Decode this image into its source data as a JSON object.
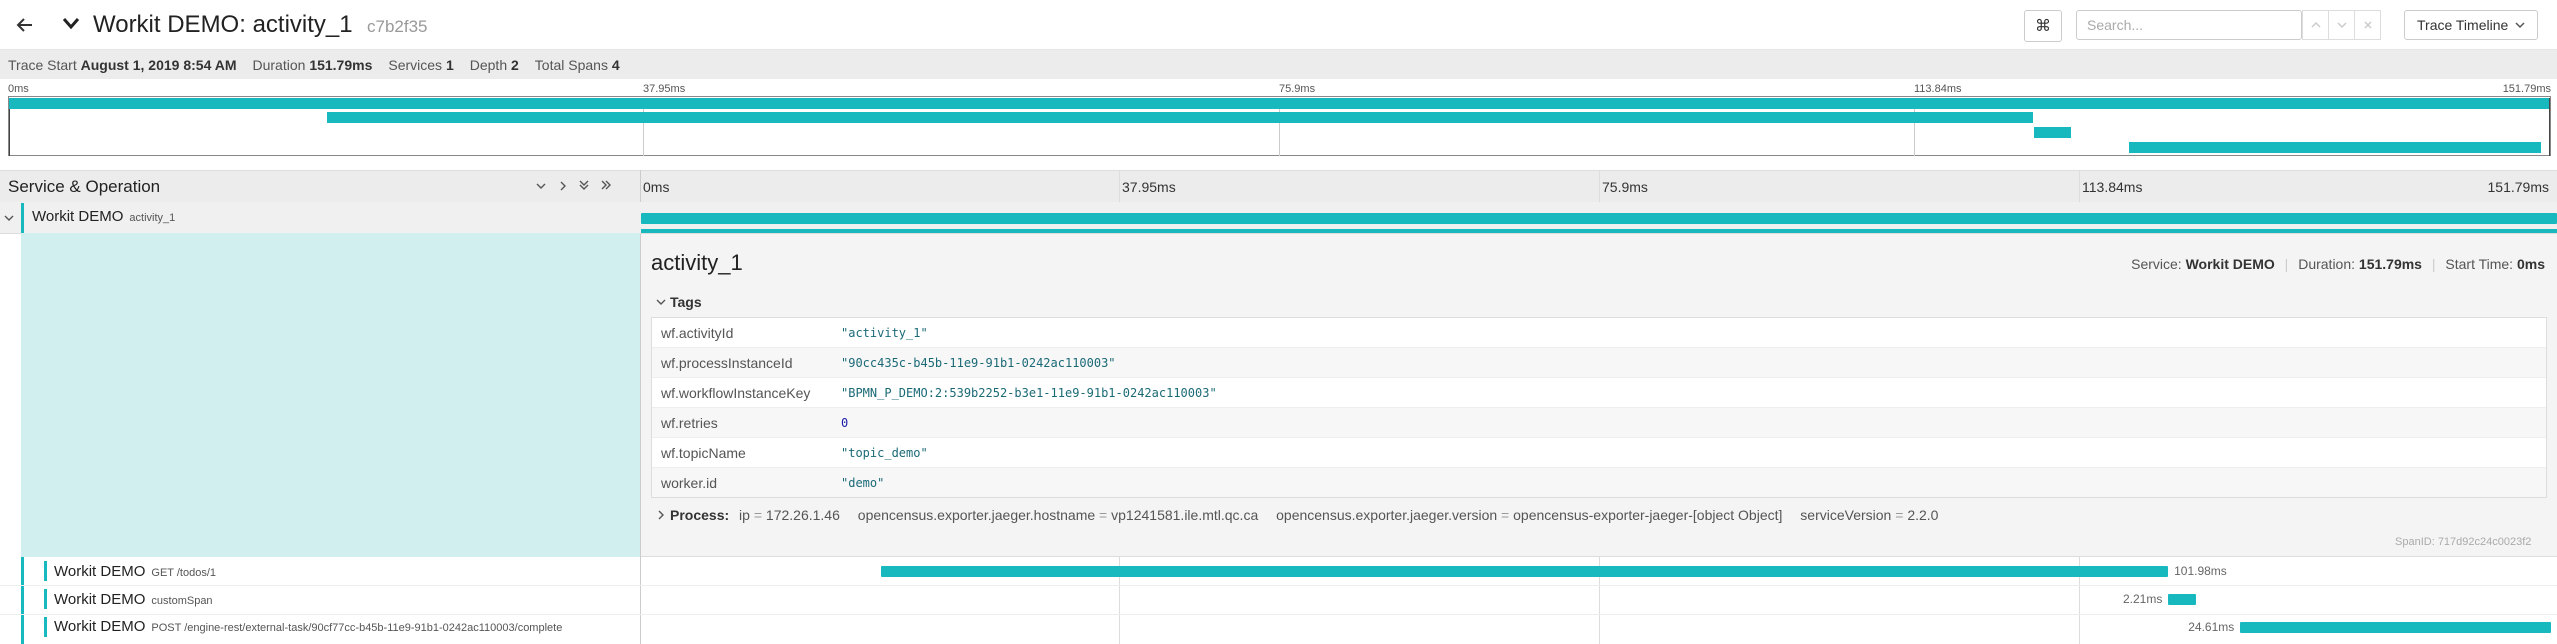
{
  "header": {
    "title": "Workit DEMO: activity_1",
    "trace_id": "c7b2f35",
    "kbd_glyph": "⌘",
    "search_placeholder": "Search...",
    "view_label": "Trace Timeline"
  },
  "summary": {
    "trace_start_label": "Trace Start",
    "trace_start_value": "August 1, 2019 8:54 AM",
    "duration_label": "Duration",
    "duration_value": "151.79ms",
    "services_label": "Services",
    "services_value": "1",
    "depth_label": "Depth",
    "depth_value": "2",
    "total_spans_label": "Total Spans",
    "total_spans_value": "4"
  },
  "minimap": {
    "ticks": [
      "0ms",
      "37.95ms",
      "75.9ms",
      "113.84ms",
      "151.79ms"
    ]
  },
  "timeline": {
    "column_header": "Service & Operation",
    "ticks": [
      "0ms",
      "37.95ms",
      "75.9ms",
      "113.84ms",
      "151.79ms"
    ]
  },
  "spans": [
    {
      "service": "Workit DEMO",
      "operation": "activity_1",
      "start_ms": 0,
      "duration_ms": 151.79,
      "duration_label": ""
    },
    {
      "service": "Workit DEMO",
      "operation": "GET /todos/1",
      "start_ms": 19.0,
      "duration_ms": 101.98,
      "duration_label": "101.98ms"
    },
    {
      "service": "Workit DEMO",
      "operation": "customSpan",
      "start_ms": 121.0,
      "duration_ms": 2.21,
      "duration_label": "2.21ms"
    },
    {
      "service": "Workit DEMO",
      "operation": "POST /engine-rest/external-task/90cf77cc-b45b-11e9-91b1-0242ac110003/complete",
      "start_ms": 126.7,
      "duration_ms": 24.61,
      "duration_label": "24.61ms"
    }
  ],
  "detail": {
    "title": "activity_1",
    "service_label": "Service:",
    "service_value": "Workit DEMO",
    "duration_label": "Duration:",
    "duration_value": "151.79ms",
    "start_label": "Start Time:",
    "start_value": "0ms",
    "tags_label": "Tags",
    "tags": [
      {
        "key": "wf.activityId",
        "value": "\"activity_1\""
      },
      {
        "key": "wf.processInstanceId",
        "value": "\"90cc435c-b45b-11e9-91b1-0242ac110003\""
      },
      {
        "key": "wf.workflowInstanceKey",
        "value": "\"BPMN_P_DEMO:2:539b2252-b3e1-11e9-91b1-0242ac110003\""
      },
      {
        "key": "wf.retries",
        "value": "0"
      },
      {
        "key": "wf.topicName",
        "value": "\"topic_demo\""
      },
      {
        "key": "worker.id",
        "value": "\"demo\""
      }
    ],
    "process_label": "Process:",
    "process_items": [
      {
        "key": "ip",
        "value": "172.26.1.46"
      },
      {
        "key": "opencensus.exporter.jaeger.hostname",
        "value": "vp1241581.ile.mtl.qc.ca"
      },
      {
        "key": "opencensus.exporter.jaeger.version",
        "value": "opencensus-exporter-jaeger-[object Object]"
      },
      {
        "key": "serviceVersion",
        "value": "2.2.0"
      }
    ],
    "span_id_label": "SpanID:",
    "span_id_value": "717d92c24c0023f2"
  },
  "colors": {
    "accent": "#17b8be",
    "detail_bg": "#d2efef"
  }
}
